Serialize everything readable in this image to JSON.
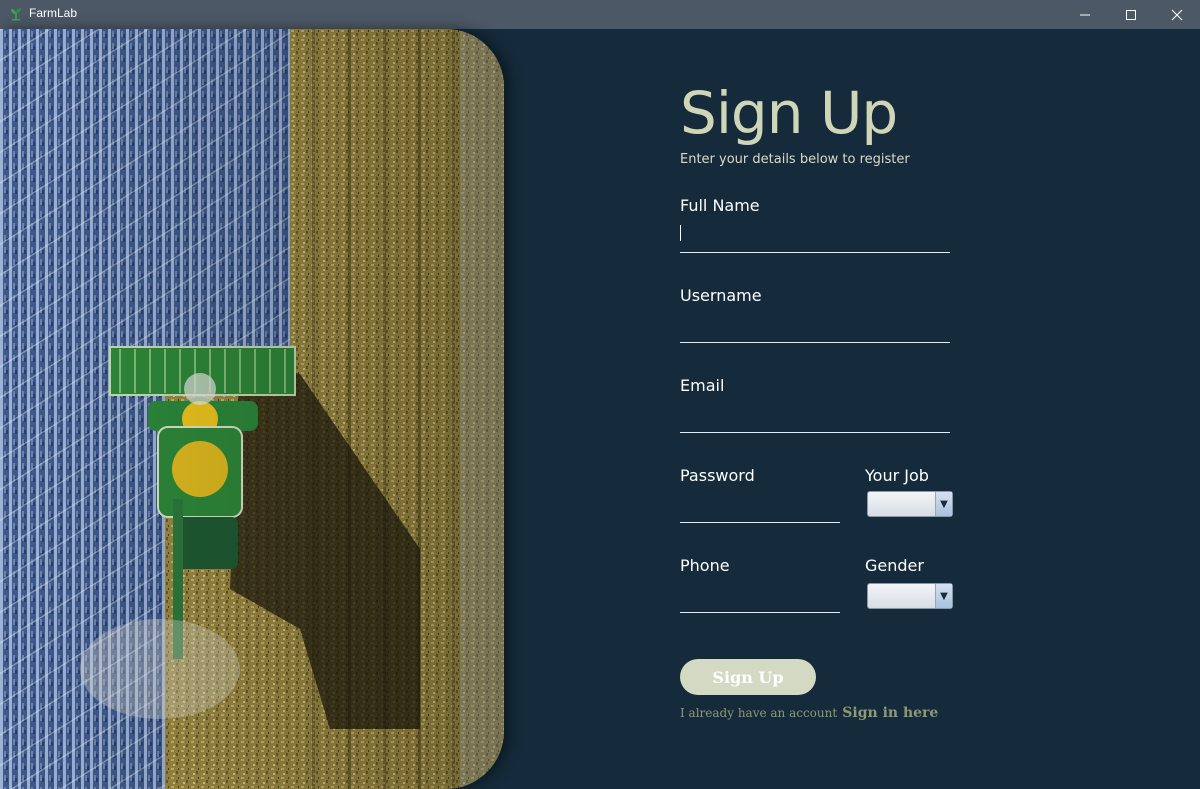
{
  "window": {
    "title": "FarmLab",
    "icon": "plant-icon",
    "controls": [
      "minimize-icon",
      "maximize-icon",
      "close-icon"
    ]
  },
  "hero": {
    "image": "aerial-harvester-photo"
  },
  "form": {
    "title": "Sign Up",
    "subtitle": "Enter your details below to register",
    "fields": {
      "full_name": {
        "label": "Full Name",
        "value": ""
      },
      "username": {
        "label": "Username",
        "value": ""
      },
      "email": {
        "label": "Email",
        "value": ""
      },
      "password": {
        "label": "Password",
        "value": ""
      },
      "phone": {
        "label": "Phone",
        "value": ""
      }
    },
    "selects": {
      "job": {
        "label": "Your Job",
        "value": ""
      },
      "gender": {
        "label": "Gender",
        "value": ""
      }
    },
    "submit_label": "Sign Up",
    "account_prompt": "I already have an account",
    "signin_label": "Sign in here"
  },
  "colors": {
    "background": "#152b3b",
    "titlebar": "#4c5866",
    "heading": "#cfd5b6",
    "button": "#d4d9c4",
    "link": "#8c9a75"
  }
}
